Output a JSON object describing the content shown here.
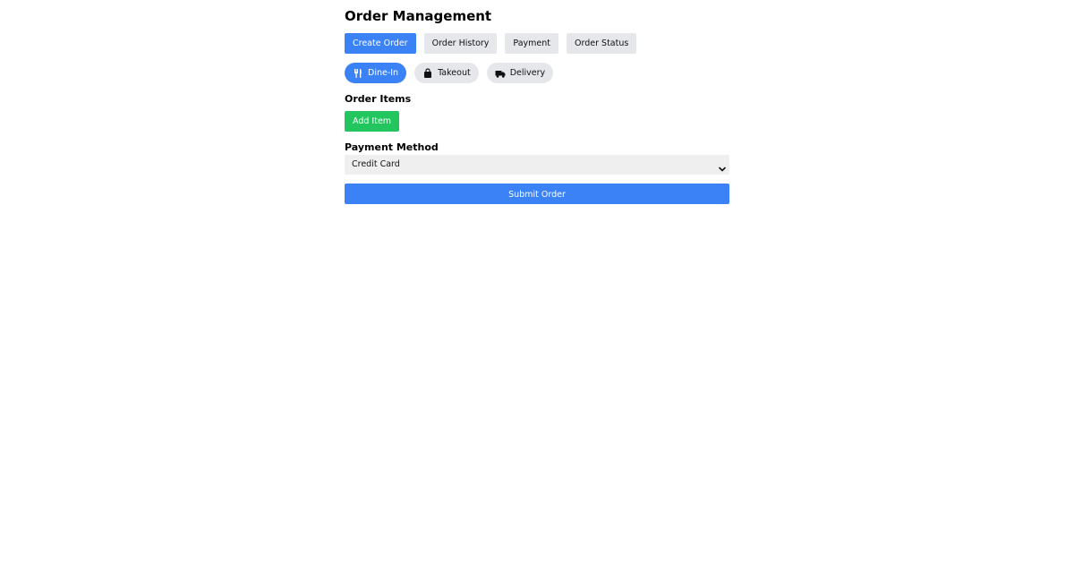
{
  "page": {
    "title": "Order Management"
  },
  "tabs": [
    {
      "label": "Create Order",
      "active": true
    },
    {
      "label": "Order History",
      "active": false
    },
    {
      "label": "Payment",
      "active": false
    },
    {
      "label": "Order Status",
      "active": false
    }
  ],
  "order_types": [
    {
      "label": "Dine-In",
      "icon": "utensils-icon",
      "active": true
    },
    {
      "label": "Takeout",
      "icon": "shopping-bag-icon",
      "active": false
    },
    {
      "label": "Delivery",
      "icon": "truck-icon",
      "active": false
    }
  ],
  "order_items": {
    "label": "Order Items",
    "add_button": "Add Item"
  },
  "payment": {
    "label": "Payment Method",
    "selected": "Credit Card"
  },
  "submit_label": "Submit Order",
  "colors": {
    "primary": "#3b82f6",
    "success": "#22c55e",
    "neutral": "#e5e7eb"
  }
}
